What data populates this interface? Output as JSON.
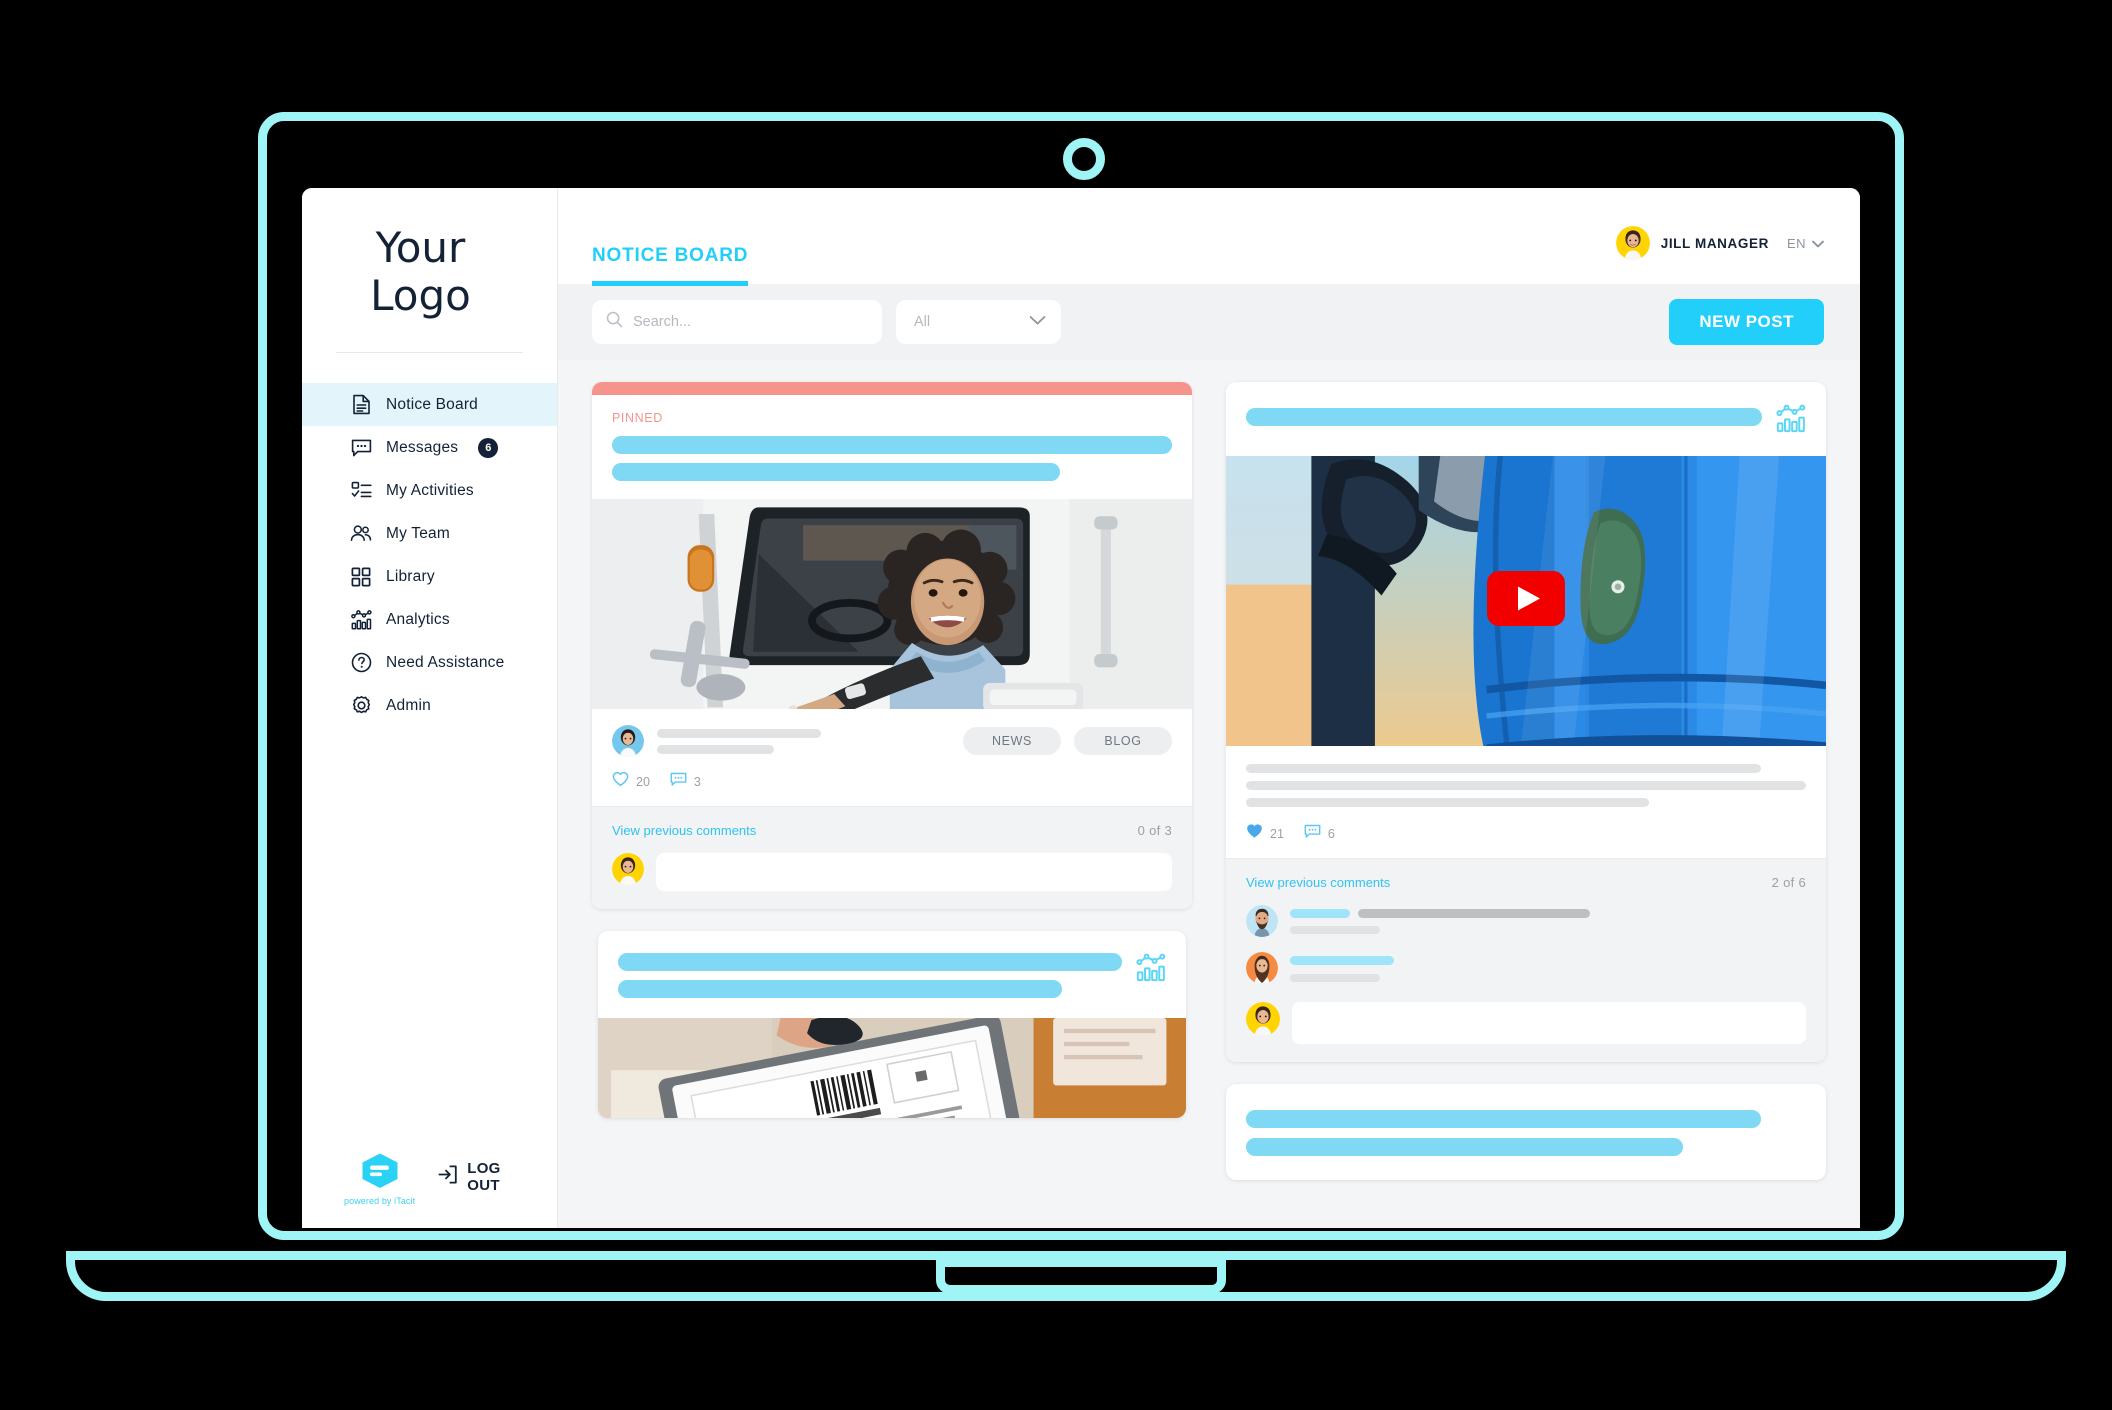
{
  "device": {
    "frame": "laptop",
    "accent_color": "#9ff5f5"
  },
  "brand": {
    "logo_line1": "Your",
    "logo_line2": "Logo",
    "powered_by": "powered by iTacit",
    "primary_color": "#22cffb",
    "dark_color": "#132236",
    "pinned_color": "#f4948c"
  },
  "sidebar": {
    "items": [
      {
        "label": "Notice Board",
        "icon": "document-icon",
        "active": true,
        "badge": null
      },
      {
        "label": "Messages",
        "icon": "chat-bubble-icon",
        "active": false,
        "badge": "6"
      },
      {
        "label": "My Activities",
        "icon": "checklist-icon",
        "active": false,
        "badge": null
      },
      {
        "label": "My Team",
        "icon": "people-icon",
        "active": false,
        "badge": null
      },
      {
        "label": "Library",
        "icon": "grid-icon",
        "active": false,
        "badge": null
      },
      {
        "label": "Analytics",
        "icon": "analytics-icon",
        "active": false,
        "badge": null
      },
      {
        "label": "Need Assistance",
        "icon": "question-circle-icon",
        "active": false,
        "badge": null
      },
      {
        "label": "Admin",
        "icon": "gear-icon",
        "active": false,
        "badge": null
      }
    ],
    "logout_label": "LOG OUT",
    "logout_icon": "logout-arrow-icon"
  },
  "header": {
    "tab_label": "NOTICE BOARD",
    "user_name": "JILL MANAGER",
    "user_avatar": "avatar-jill",
    "language": "EN",
    "language_chevron": "chevron-down-icon"
  },
  "toolbar": {
    "search_placeholder": "Search...",
    "search_value": "",
    "search_icon": "search-icon",
    "filter_value": "All",
    "filter_options": [
      "All"
    ],
    "filter_chevron": "chevron-down-icon",
    "new_post_label": "NEW POST"
  },
  "feed": {
    "left_column": [
      {
        "id": "post-pinned-truck-driver",
        "pinned": true,
        "pinned_label": "PINNED",
        "has_analytics_icon": false,
        "image": "woman-truck-driver-photo",
        "media_type": "image",
        "tags": [
          "NEWS",
          "BLOG"
        ],
        "likes": "20",
        "like_state": "unliked",
        "comments": "3",
        "comment_link": "View previous comments",
        "comment_counter": "0 of 3",
        "visible_comments": [],
        "author_avatar": "avatar-blue-woman",
        "reply_avatar": "avatar-yellow-woman"
      },
      {
        "id": "post-tablet-shipping-label",
        "pinned": false,
        "pinned_label": null,
        "has_analytics_icon": true,
        "image": "tablet-shipping-label-photo",
        "media_type": "image",
        "tags": [],
        "likes": null,
        "comments": null,
        "comment_link": null,
        "comment_counter": null,
        "visible_comments": []
      }
    ],
    "right_column": [
      {
        "id": "post-video-blue-truck",
        "pinned": false,
        "pinned_label": null,
        "has_analytics_icon": true,
        "image": "blue-truck-video-thumbnail",
        "media_type": "video",
        "play_button": "youtube-play-icon",
        "tags": [],
        "likes": "21",
        "like_state": "liked",
        "comments": "6",
        "comment_link": "View previous comments",
        "comment_counter": "2 of  6",
        "visible_comments": [
          {
            "avatar": "avatar-bearded-man"
          },
          {
            "avatar": "avatar-orange-woman"
          }
        ],
        "reply_avatar": "avatar-yellow-woman"
      },
      {
        "id": "post-bottom-partial",
        "pinned": false,
        "pinned_label": null,
        "has_analytics_icon": false,
        "image": null,
        "media_type": null,
        "tags": [],
        "likes": null,
        "comments": null,
        "comment_link": null,
        "comment_counter": null,
        "visible_comments": []
      }
    ]
  }
}
